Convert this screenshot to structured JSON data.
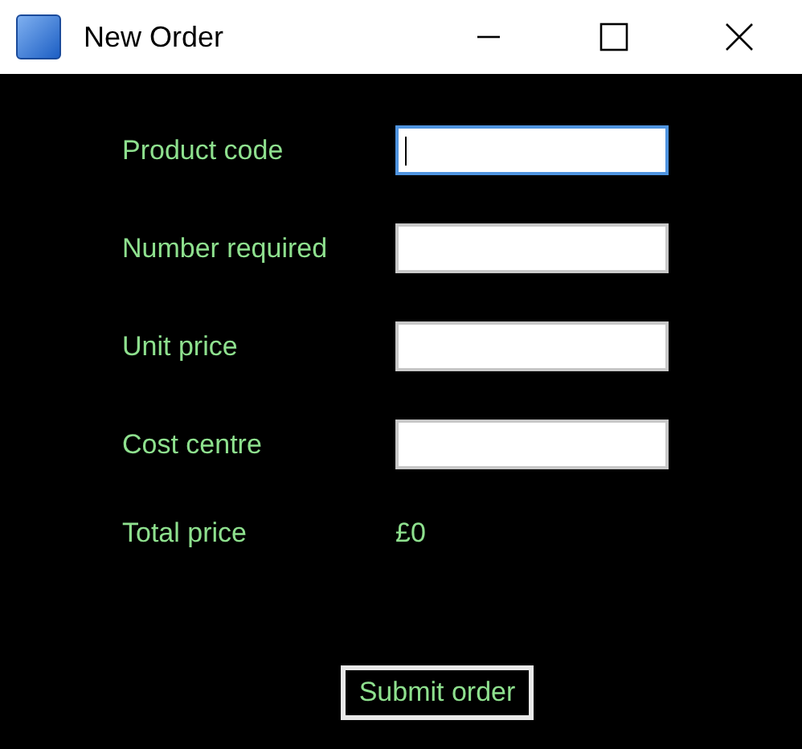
{
  "window": {
    "title": "New Order"
  },
  "fields": [
    {
      "label": "Product code",
      "focused": true
    },
    {
      "label": "Number required",
      "focused": false
    },
    {
      "label": "Unit price",
      "focused": false
    },
    {
      "label": "Cost centre",
      "focused": false
    }
  ],
  "total": {
    "label": "Total price",
    "value": "£0"
  },
  "buttons": [
    {
      "label": "Submit order"
    }
  ]
}
